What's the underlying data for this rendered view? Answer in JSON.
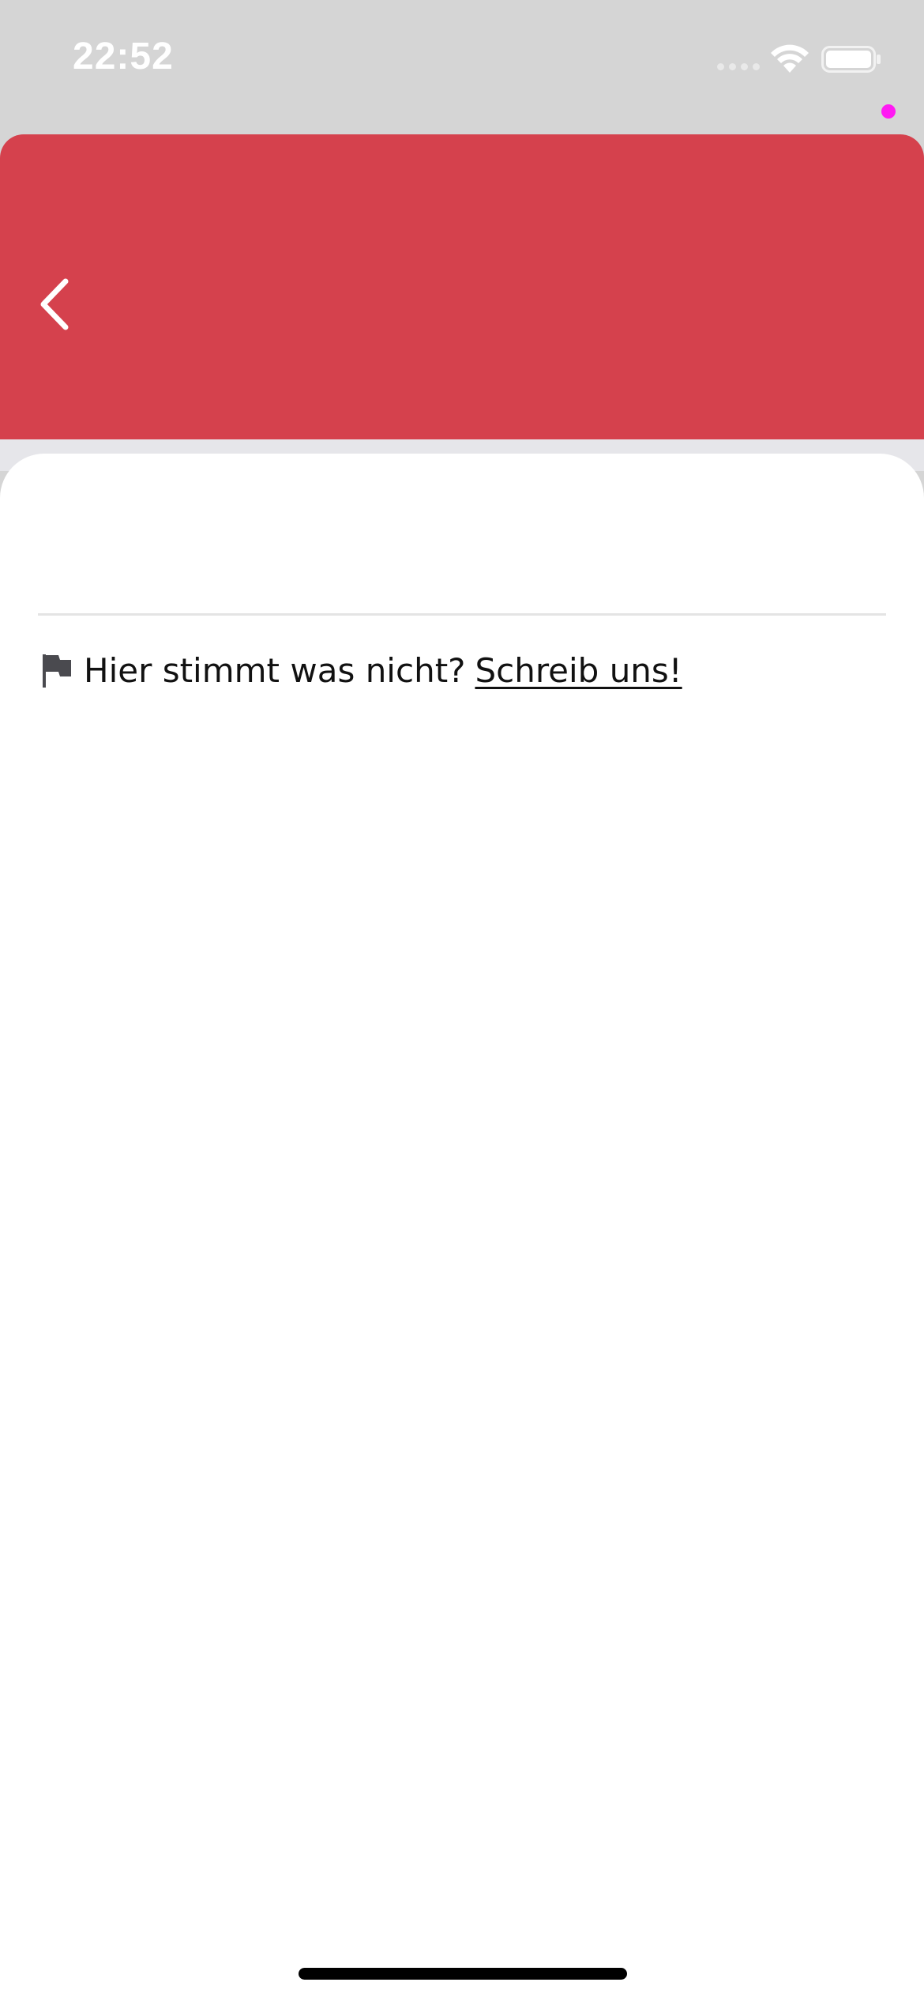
{
  "status_bar": {
    "time": "22:52",
    "icons": [
      "signal-dots-icon",
      "wifi-icon",
      "battery-icon"
    ]
  },
  "header": {
    "background_color": "#d5414d",
    "back_icon": "chevron-left-icon"
  },
  "content": {
    "report_prompt": "Hier stimmt was nicht?",
    "report_link": "Schreib uns!",
    "report_icon": "flag-icon"
  },
  "colors": {
    "accent": "#d5414d",
    "status_bar_bg": "#d5d5d5",
    "recording_indicator": "#ff1af3"
  }
}
